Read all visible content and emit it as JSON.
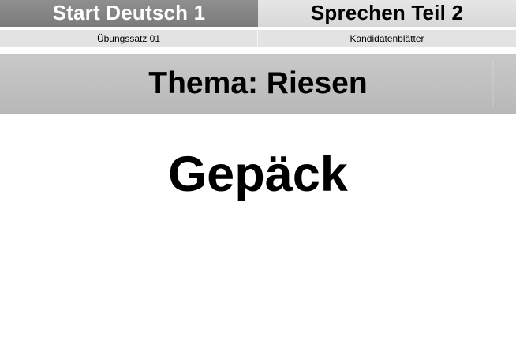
{
  "header": {
    "left_title": "Start Deutsch 1",
    "right_title": "Sprechen Teil 2"
  },
  "subheader": {
    "left_label": "Übungssatz 01",
    "right_label": "Kandidatenblätter"
  },
  "topic": {
    "label": "Thema: Riesen"
  },
  "card": {
    "word": "Gepäck"
  },
  "colors": {
    "header_left_bg": "#858585",
    "header_right_bg": "#dedede",
    "subheader_bg": "#e3e3e3",
    "topic_bg": "#c0c0c0"
  }
}
